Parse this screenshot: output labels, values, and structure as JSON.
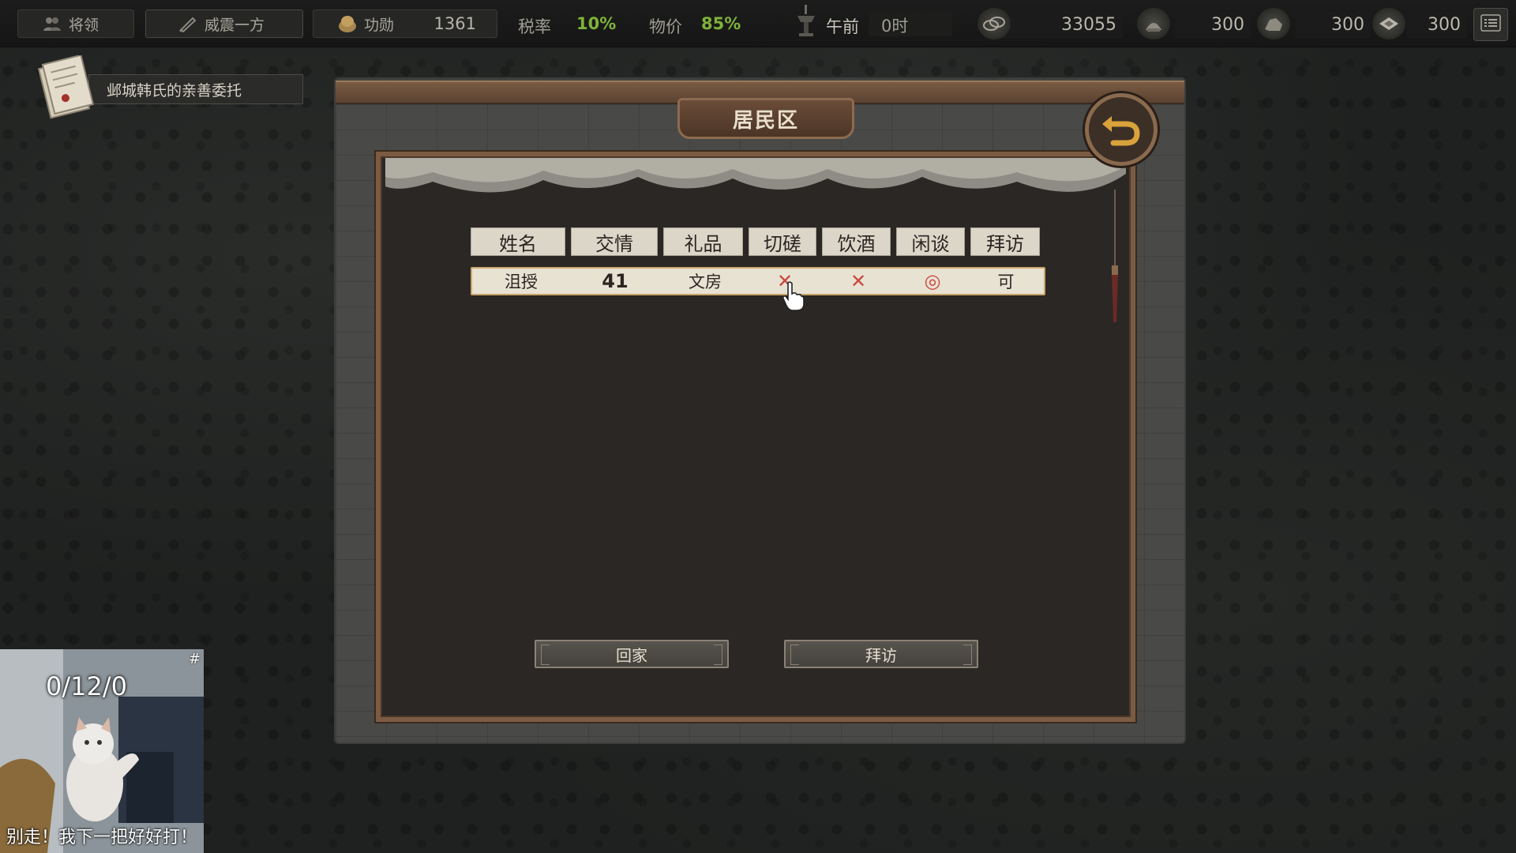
{
  "topbar": {
    "generals_label": "将领",
    "title_label": "威震一方",
    "merit_label": "功勋",
    "merit_value": "1361",
    "tax_label": "税率",
    "tax_value": "10%",
    "price_label": "物价",
    "price_value": "85%",
    "time_period": "午前",
    "time_hour": "0时",
    "resources": [
      {
        "icon": "coins-icon",
        "value": "33055"
      },
      {
        "icon": "grain-icon",
        "value": "300"
      },
      {
        "icon": "ore-icon",
        "value": "300"
      },
      {
        "icon": "cloth-icon",
        "value": "300"
      }
    ]
  },
  "quest": {
    "title": "邺城韩氏的亲善委托"
  },
  "panel": {
    "title": "居民区",
    "columns": [
      "姓名",
      "交情",
      "礼品",
      "切磋",
      "饮酒",
      "闲谈",
      "拜访"
    ],
    "rows": [
      {
        "name": "沮授",
        "friendship": "41",
        "gift": "文房",
        "spar": "✕",
        "drink": "✕",
        "chat": "◎",
        "visit": "可"
      }
    ],
    "buttons": {
      "home": "回家",
      "visit": "拜访"
    }
  },
  "webcam": {
    "counter": "0/12/0",
    "caption": "别走！我下一把好好打！",
    "corner": "#"
  },
  "colors": {
    "green_value": "#7fb23a",
    "cross_red": "#c8473d",
    "frame_brown": "#7b5b43",
    "row_border": "#c9a56a"
  }
}
